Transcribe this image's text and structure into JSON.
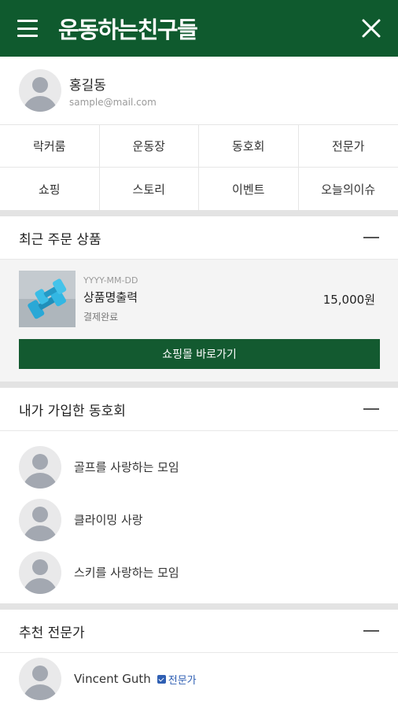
{
  "header": {
    "logo_text": "운동하는친구들",
    "menu_icon": "hamburger-icon",
    "close_icon": "close-icon",
    "color": "#0f5a2e"
  },
  "profile": {
    "name": "홍길동",
    "email": "sample@mail.com"
  },
  "menu": {
    "items": [
      "락커룸",
      "운동장",
      "동호회",
      "전문가",
      "쇼핑",
      "스토리",
      "이벤트",
      "오늘의이슈"
    ]
  },
  "recent_orders": {
    "title": "최근 주문 상품",
    "order": {
      "date": "YYYY-MM-DD",
      "name": "상품명출력",
      "status": "결제완료",
      "price": "15,000원"
    },
    "shop_button": "쇼핑몰 바로가기"
  },
  "my_clubs": {
    "title": "내가 가입한 동호회",
    "items": [
      "골프를 사랑하는 모임",
      "클라이밍 사랑",
      "스키를 사랑하는 모임"
    ]
  },
  "experts": {
    "title": "추천 전문가",
    "items": [
      {
        "name": "Vincent Guth",
        "badge": "전문가"
      }
    ]
  }
}
